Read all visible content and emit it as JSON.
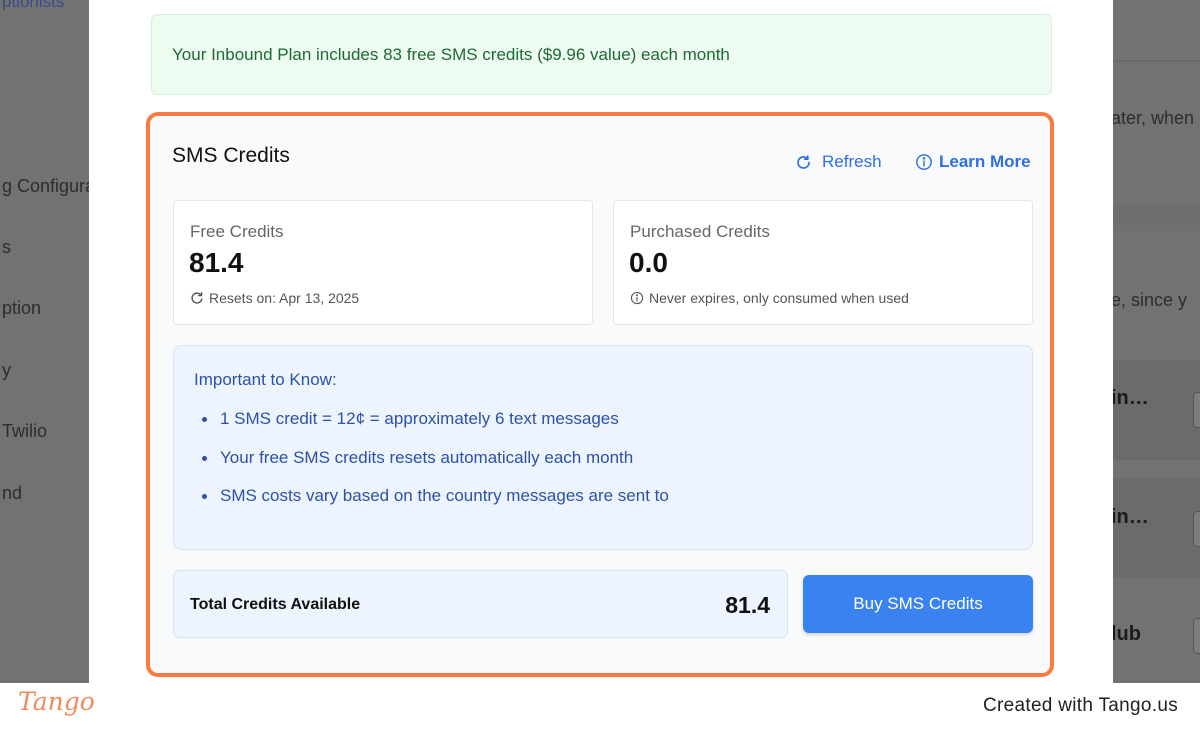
{
  "background": {
    "sidebar_top": "ptionists",
    "sidebar_items": [
      "g Configura",
      "s",
      "ption",
      "y",
      "Twilio",
      "nd"
    ],
    "right_snippets": [
      "ater, when",
      "e, since y"
    ],
    "right_bold": [
      "in…",
      "in…",
      "lub"
    ]
  },
  "banner": {
    "text": "Your Inbound Plan includes 83 free SMS credits ($9.96 value) each month"
  },
  "credits": {
    "title": "SMS Credits",
    "refresh_label": "Refresh",
    "learn_more_label": "Learn More",
    "free": {
      "label": "Free Credits",
      "value": "81.4",
      "note": "Resets on: Apr 13, 2025"
    },
    "purchased": {
      "label": "Purchased Credits",
      "value": "0.0",
      "note": "Never expires, only consumed when used"
    },
    "info": {
      "title": "Important to Know:",
      "items": [
        "1 SMS credit = 12¢ = approximately 6 text messages",
        "Your free SMS credits resets automatically each month",
        "SMS costs vary based on the country messages are sent to"
      ]
    },
    "total_label": "Total Credits Available",
    "total_value": "81.4",
    "buy_label": "Buy SMS Credits"
  },
  "footer": {
    "logo": "Tango",
    "created": "Created with Tango.us"
  },
  "colors": {
    "accent": "#2f6fe4",
    "highlight_border": "#fb7a41",
    "buy_button": "#3a82f0",
    "banner_text": "#1d6a34"
  }
}
